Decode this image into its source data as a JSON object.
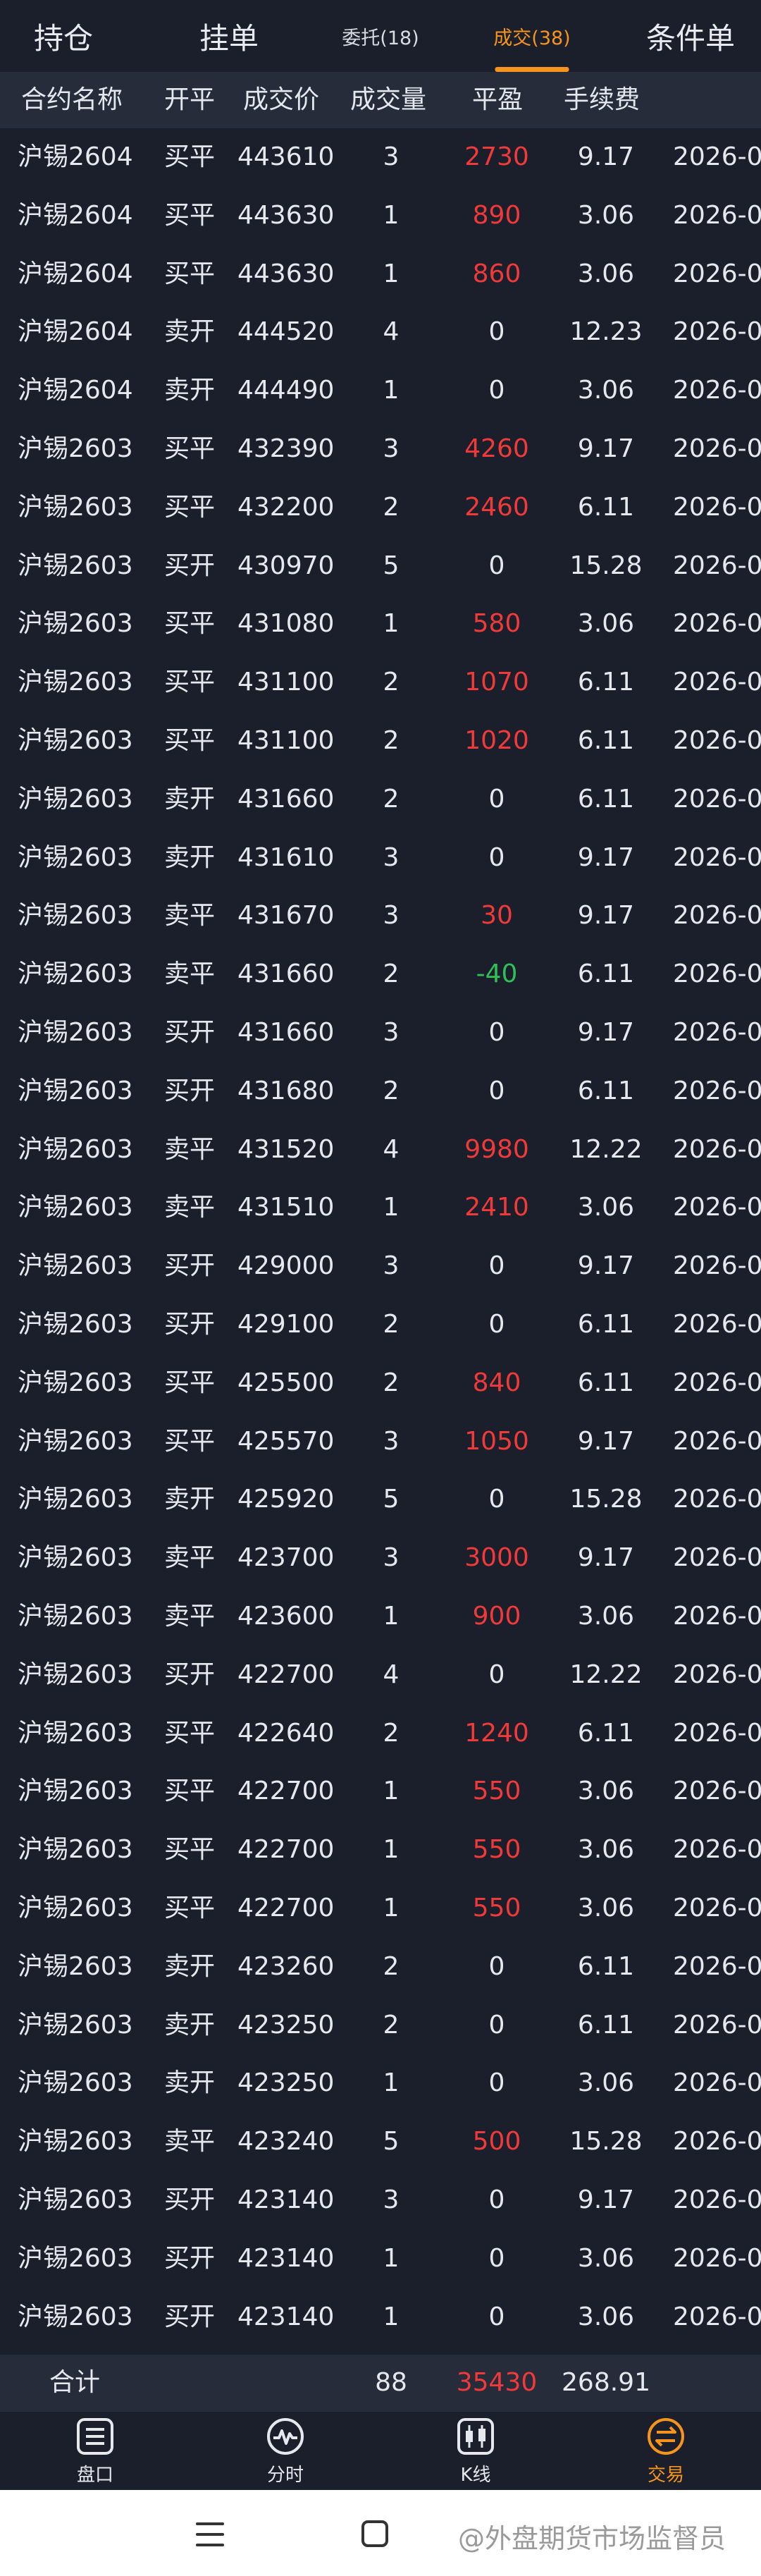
{
  "tabs": {
    "holdings": "持仓",
    "orders": "挂单",
    "entrusted": "委托(18)",
    "filled": "成交(38)",
    "conditional": "条件单"
  },
  "columns": {
    "name": "合约名称",
    "direction": "开平",
    "price": "成交价",
    "quantity": "成交量",
    "pnl": "平盈",
    "fee": "手续费"
  },
  "trades": [
    {
      "name": "沪锡2604",
      "direction": "买平",
      "price": "443610",
      "quantity": "3",
      "pnl": "2730",
      "fee": "9.17",
      "time": "2026-0"
    },
    {
      "name": "沪锡2604",
      "direction": "买平",
      "price": "443630",
      "quantity": "1",
      "pnl": "890",
      "fee": "3.06",
      "time": "2026-0"
    },
    {
      "name": "沪锡2604",
      "direction": "买平",
      "price": "443630",
      "quantity": "1",
      "pnl": "860",
      "fee": "3.06",
      "time": "2026-0"
    },
    {
      "name": "沪锡2604",
      "direction": "卖开",
      "price": "444520",
      "quantity": "4",
      "pnl": "0",
      "fee": "12.23",
      "time": "2026-0"
    },
    {
      "name": "沪锡2604",
      "direction": "卖开",
      "price": "444490",
      "quantity": "1",
      "pnl": "0",
      "fee": "3.06",
      "time": "2026-0"
    },
    {
      "name": "沪锡2603",
      "direction": "买平",
      "price": "432390",
      "quantity": "3",
      "pnl": "4260",
      "fee": "9.17",
      "time": "2026-0"
    },
    {
      "name": "沪锡2603",
      "direction": "买平",
      "price": "432200",
      "quantity": "2",
      "pnl": "2460",
      "fee": "6.11",
      "time": "2026-0"
    },
    {
      "name": "沪锡2603",
      "direction": "买开",
      "price": "430970",
      "quantity": "5",
      "pnl": "0",
      "fee": "15.28",
      "time": "2026-0"
    },
    {
      "name": "沪锡2603",
      "direction": "买平",
      "price": "431080",
      "quantity": "1",
      "pnl": "580",
      "fee": "3.06",
      "time": "2026-0"
    },
    {
      "name": "沪锡2603",
      "direction": "买平",
      "price": "431100",
      "quantity": "2",
      "pnl": "1070",
      "fee": "6.11",
      "time": "2026-0"
    },
    {
      "name": "沪锡2603",
      "direction": "买平",
      "price": "431100",
      "quantity": "2",
      "pnl": "1020",
      "fee": "6.11",
      "time": "2026-0"
    },
    {
      "name": "沪锡2603",
      "direction": "卖开",
      "price": "431660",
      "quantity": "2",
      "pnl": "0",
      "fee": "6.11",
      "time": "2026-0"
    },
    {
      "name": "沪锡2603",
      "direction": "卖开",
      "price": "431610",
      "quantity": "3",
      "pnl": "0",
      "fee": "9.17",
      "time": "2026-0"
    },
    {
      "name": "沪锡2603",
      "direction": "卖平",
      "price": "431670",
      "quantity": "3",
      "pnl": "30",
      "fee": "9.17",
      "time": "2026-0"
    },
    {
      "name": "沪锡2603",
      "direction": "卖平",
      "price": "431660",
      "quantity": "2",
      "pnl": "-40",
      "fee": "6.11",
      "time": "2026-0"
    },
    {
      "name": "沪锡2603",
      "direction": "买开",
      "price": "431660",
      "quantity": "3",
      "pnl": "0",
      "fee": "9.17",
      "time": "2026-0"
    },
    {
      "name": "沪锡2603",
      "direction": "买开",
      "price": "431680",
      "quantity": "2",
      "pnl": "0",
      "fee": "6.11",
      "time": "2026-0"
    },
    {
      "name": "沪锡2603",
      "direction": "卖平",
      "price": "431520",
      "quantity": "4",
      "pnl": "9980",
      "fee": "12.22",
      "time": "2026-0"
    },
    {
      "name": "沪锡2603",
      "direction": "卖平",
      "price": "431510",
      "quantity": "1",
      "pnl": "2410",
      "fee": "3.06",
      "time": "2026-0"
    },
    {
      "name": "沪锡2603",
      "direction": "买开",
      "price": "429000",
      "quantity": "3",
      "pnl": "0",
      "fee": "9.17",
      "time": "2026-0"
    },
    {
      "name": "沪锡2603",
      "direction": "买开",
      "price": "429100",
      "quantity": "2",
      "pnl": "0",
      "fee": "6.11",
      "time": "2026-0"
    },
    {
      "name": "沪锡2603",
      "direction": "买平",
      "price": "425500",
      "quantity": "2",
      "pnl": "840",
      "fee": "6.11",
      "time": "2026-0"
    },
    {
      "name": "沪锡2603",
      "direction": "买平",
      "price": "425570",
      "quantity": "3",
      "pnl": "1050",
      "fee": "9.17",
      "time": "2026-0"
    },
    {
      "name": "沪锡2603",
      "direction": "卖开",
      "price": "425920",
      "quantity": "5",
      "pnl": "0",
      "fee": "15.28",
      "time": "2026-0"
    },
    {
      "name": "沪锡2603",
      "direction": "卖平",
      "price": "423700",
      "quantity": "3",
      "pnl": "3000",
      "fee": "9.17",
      "time": "2026-0"
    },
    {
      "name": "沪锡2603",
      "direction": "卖平",
      "price": "423600",
      "quantity": "1",
      "pnl": "900",
      "fee": "3.06",
      "time": "2026-0"
    },
    {
      "name": "沪锡2603",
      "direction": "买开",
      "price": "422700",
      "quantity": "4",
      "pnl": "0",
      "fee": "12.22",
      "time": "2026-0"
    },
    {
      "name": "沪锡2603",
      "direction": "买平",
      "price": "422640",
      "quantity": "2",
      "pnl": "1240",
      "fee": "6.11",
      "time": "2026-0"
    },
    {
      "name": "沪锡2603",
      "direction": "买平",
      "price": "422700",
      "quantity": "1",
      "pnl": "550",
      "fee": "3.06",
      "time": "2026-0"
    },
    {
      "name": "沪锡2603",
      "direction": "买平",
      "price": "422700",
      "quantity": "1",
      "pnl": "550",
      "fee": "3.06",
      "time": "2026-0"
    },
    {
      "name": "沪锡2603",
      "direction": "买平",
      "price": "422700",
      "quantity": "1",
      "pnl": "550",
      "fee": "3.06",
      "time": "2026-0"
    },
    {
      "name": "沪锡2603",
      "direction": "卖开",
      "price": "423260",
      "quantity": "2",
      "pnl": "0",
      "fee": "6.11",
      "time": "2026-0"
    },
    {
      "name": "沪锡2603",
      "direction": "卖开",
      "price": "423250",
      "quantity": "2",
      "pnl": "0",
      "fee": "6.11",
      "time": "2026-0"
    },
    {
      "name": "沪锡2603",
      "direction": "卖开",
      "price": "423250",
      "quantity": "1",
      "pnl": "0",
      "fee": "3.06",
      "time": "2026-0"
    },
    {
      "name": "沪锡2603",
      "direction": "卖平",
      "price": "423240",
      "quantity": "5",
      "pnl": "500",
      "fee": "15.28",
      "time": "2026-0"
    },
    {
      "name": "沪锡2603",
      "direction": "买开",
      "price": "423140",
      "quantity": "3",
      "pnl": "0",
      "fee": "9.17",
      "time": "2026-0"
    },
    {
      "name": "沪锡2603",
      "direction": "买开",
      "price": "423140",
      "quantity": "1",
      "pnl": "0",
      "fee": "3.06",
      "time": "2026-0"
    },
    {
      "name": "沪锡2603",
      "direction": "买开",
      "price": "423140",
      "quantity": "1",
      "pnl": "0",
      "fee": "3.06",
      "time": "2026-0"
    }
  ],
  "totals": {
    "label": "合计",
    "quantity": "88",
    "pnl": "35430",
    "fee": "268.91"
  },
  "bottom_nav": {
    "market": "盘口",
    "timeshare": "分时",
    "kline": "K线",
    "trade": "交易"
  },
  "watermark": "@外盘期货市场监督员",
  "colors": {
    "background": "#1a1f2b",
    "header_bg": "#262c3a",
    "accent": "#f7941d",
    "profit": "#f03a3a",
    "loss": "#2fbf57"
  }
}
